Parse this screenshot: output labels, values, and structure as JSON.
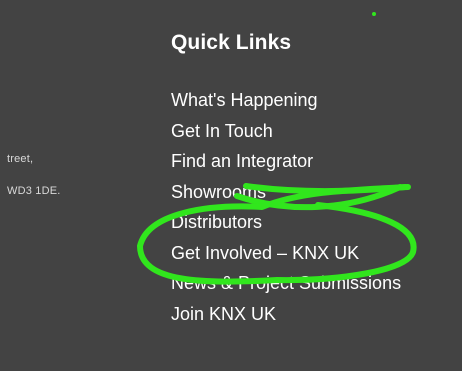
{
  "footer": {
    "address_lines": [
      "treet,",
      "WD3 1DE."
    ]
  },
  "quick_links": {
    "title": "Quick Links",
    "items": [
      {
        "label": "What's Happening"
      },
      {
        "label": "Get In Touch"
      },
      {
        "label": "Find an Integrator"
      },
      {
        "label": "Showrooms"
      },
      {
        "label": "Distributors"
      },
      {
        "label": "Get Involved – KNX UK"
      },
      {
        "label": "News & Project Submissions"
      },
      {
        "label": "Join KNX UK"
      }
    ]
  },
  "annotation": {
    "color": "#31e61d"
  }
}
